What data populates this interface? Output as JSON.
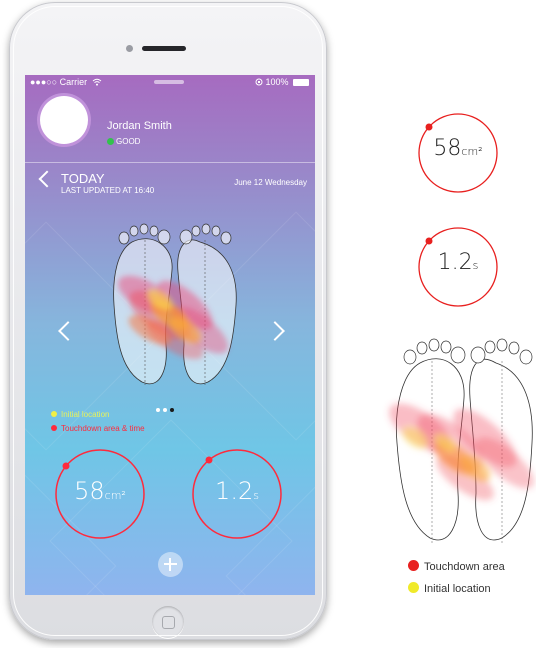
{
  "status_bar": {
    "carrier": "●●●○○ Carrier",
    "battery": "100%"
  },
  "profile": {
    "name": "Jordan Smith",
    "status": "GOOD"
  },
  "header": {
    "title": "TODAY",
    "updated": "LAST UPDATED AT 16:40",
    "date": "June 12 Wednesday"
  },
  "pager": {
    "pages": 3,
    "active": 2
  },
  "legend_screen": [
    {
      "label": "Initial location",
      "color": "#f0f045"
    },
    {
      "label": "Touchdown area & time",
      "color": "#ff2a3c"
    }
  ],
  "metrics": {
    "area": {
      "value": "58",
      "unit": "cm²"
    },
    "time": {
      "value": "1.2",
      "unit": "s"
    }
  },
  "legend_side": [
    {
      "label": "Touchdown area",
      "color": "#e8201f"
    },
    {
      "label": "Initial location",
      "color": "#f0ea2a"
    }
  ],
  "colors": {
    "accent_red": "#e8201f",
    "ring_screen": "#ff2a3c"
  }
}
